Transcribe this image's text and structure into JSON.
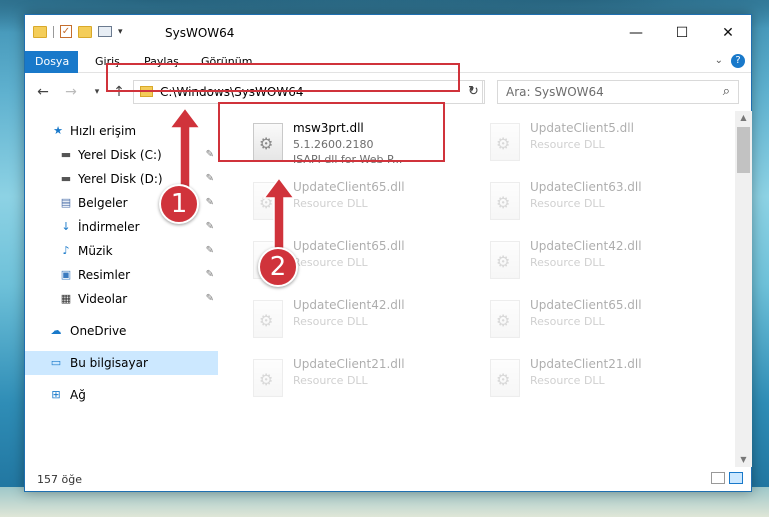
{
  "window": {
    "title": "SysWOW64"
  },
  "controls": {
    "minimize": "—",
    "maximize": "☐",
    "close": "✕"
  },
  "ribbon": {
    "tabs": [
      "Dosya",
      "Giriş",
      "Paylaş",
      "Görünüm"
    ]
  },
  "address": {
    "path": "C:\\Windows\\SysWOW64"
  },
  "search": {
    "placeholder": "Ara: SysWOW64"
  },
  "sidebar": {
    "quick_access": "Hızlı erişim",
    "items": [
      {
        "label": "Yerel Disk (C:)",
        "icon": "drive-icon",
        "pinned": true
      },
      {
        "label": "Yerel Disk (D:)",
        "icon": "drive-icon",
        "pinned": true
      },
      {
        "label": "Belgeler",
        "icon": "documents-icon",
        "pinned": true
      },
      {
        "label": "İndirmeler",
        "icon": "download-icon",
        "pinned": true
      },
      {
        "label": "Müzik",
        "icon": "music-icon",
        "pinned": true
      },
      {
        "label": "Resimler",
        "icon": "pictures-icon",
        "pinned": true
      },
      {
        "label": "Videolar",
        "icon": "videos-icon",
        "pinned": true
      }
    ],
    "onedrive": "OneDrive",
    "this_pc": "Bu bilgisayar",
    "network": "Ağ"
  },
  "files": [
    {
      "name": "msw3prt.dll",
      "line1": "5.1.2600.2180",
      "line2": "ISAPI dll for Web P...",
      "highlighted": true
    },
    {
      "name": "UpdateClient5.dll",
      "line1": "Resource DLL"
    },
    {
      "name": "UpdateClient65.dll",
      "line1": "Resource DLL"
    },
    {
      "name": "UpdateClient63.dll",
      "line1": "Resource DLL"
    },
    {
      "name": "UpdateClient65.dll",
      "line1": "Resource DLL"
    },
    {
      "name": "UpdateClient42.dll",
      "line1": "Resource DLL"
    },
    {
      "name": "UpdateClient42.dll",
      "line1": "Resource DLL"
    },
    {
      "name": "UpdateClient65.dll",
      "line1": "Resource DLL"
    },
    {
      "name": "UpdateClient21.dll",
      "line1": "Resource DLL"
    },
    {
      "name": "UpdateClient21.dll",
      "line1": "Resource DLL"
    }
  ],
  "status": {
    "count": "157 öğe"
  },
  "callouts": [
    "1",
    "2"
  ],
  "colors": {
    "accent": "#1979ca",
    "highlight": "#d0333b",
    "selection": "#cce8ff"
  }
}
